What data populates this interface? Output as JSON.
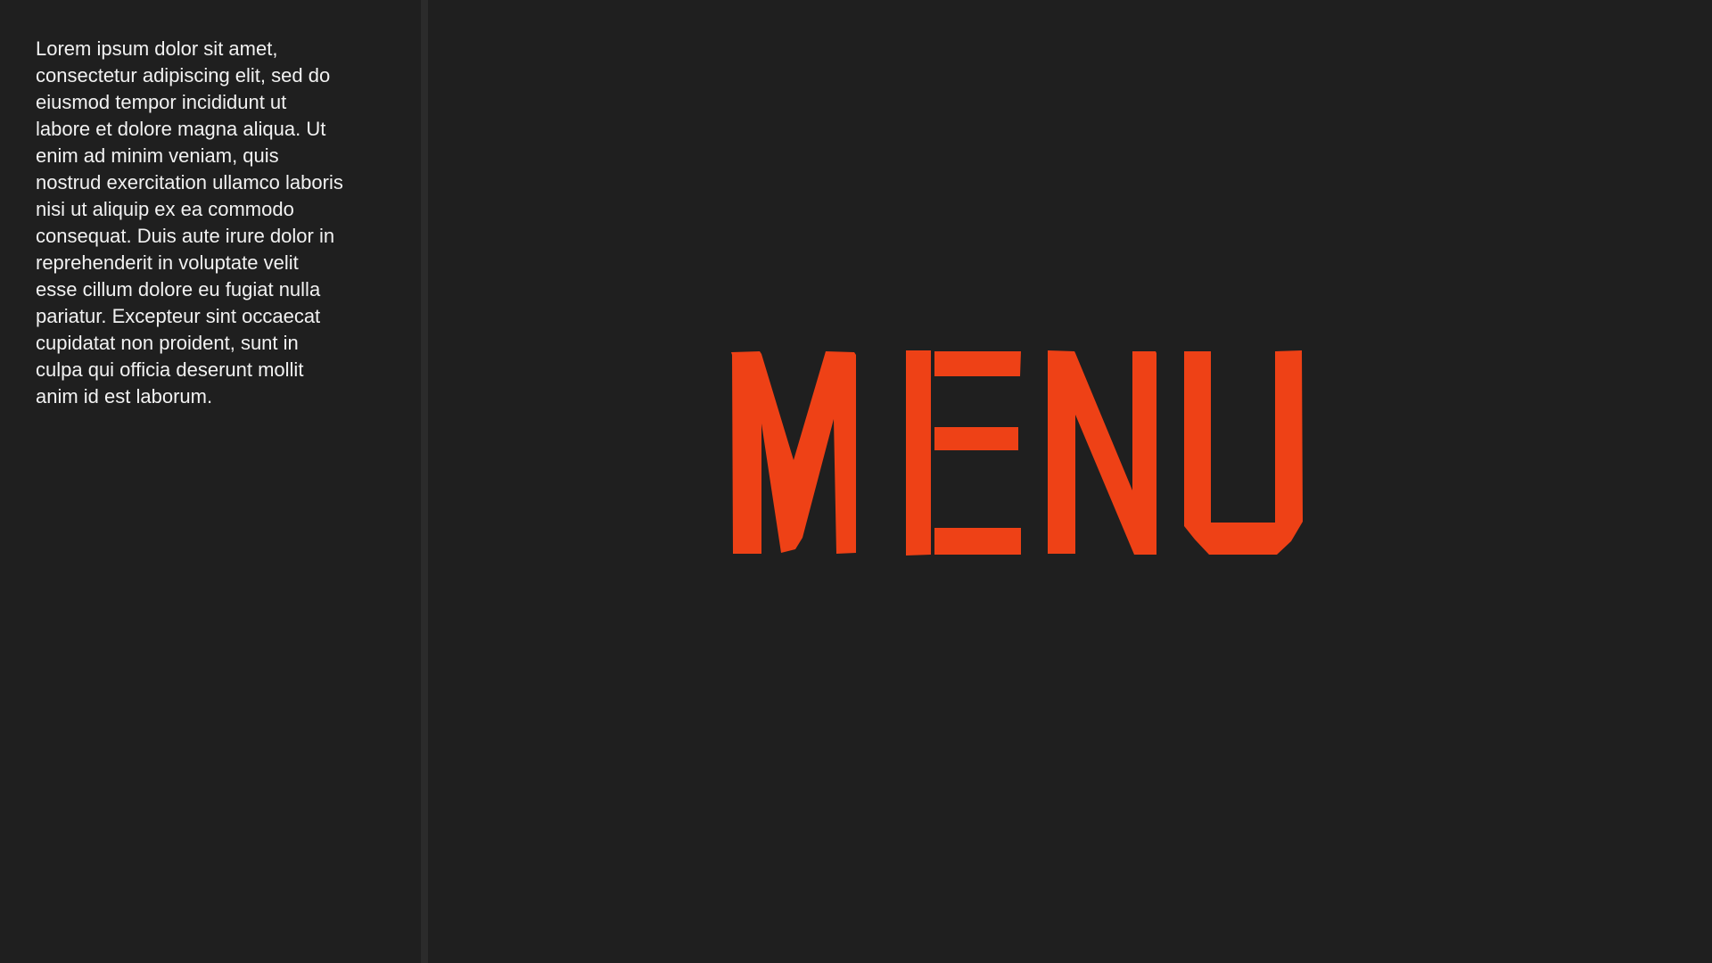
{
  "sidebar": {
    "paragraph": "Lorem ipsum dolor sit amet,\nconsectetur adipiscing elit, sed do\neiusmod  tempor incididunt ut\nlabore et dolore magna aliqua. Ut\nenim ad minim  veniam, quis\nnostrud exercitation ullamco laboris\nnisi ut aliquip ex ea  commodo\nconsequat. Duis aute irure dolor in\nreprehenderit in voluptate  velit\nesse cillum dolore eu fugiat nulla\npariatur. Excepteur sint  occaecat\ncupidatat non proident, sunt in\nculpa qui officia deserunt  mollit\nanim id est laborum."
  },
  "main": {
    "menu_label": "MENU",
    "menu_color": "#ee4116"
  },
  "colors": {
    "background": "#1f1f1f",
    "divider": "#2b2b2b",
    "text": "#f2f2f2"
  }
}
